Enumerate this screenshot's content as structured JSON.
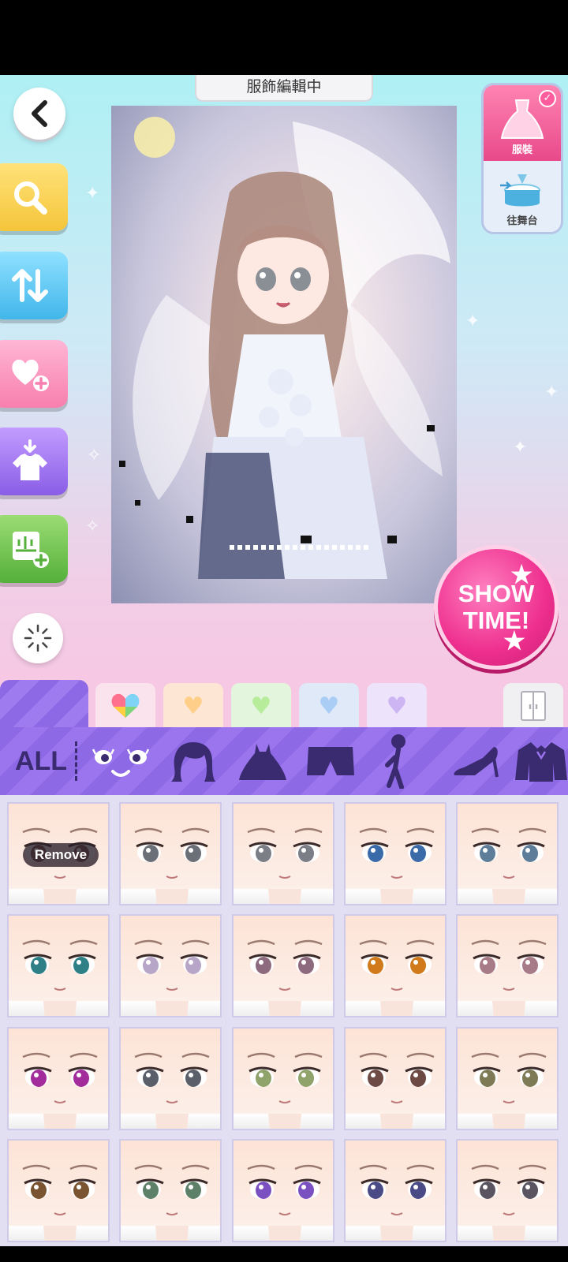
{
  "header": {
    "title": "服飾編輯中"
  },
  "side_buttons": [
    {
      "name": "back",
      "icon": "chevron-left-icon"
    },
    {
      "name": "search",
      "icon": "magnifier-icon",
      "color": "#f5c53a"
    },
    {
      "name": "sort",
      "icon": "sort-arrows-icon",
      "color": "#41b6ea"
    },
    {
      "name": "favorite-add",
      "icon": "heart-plus-icon",
      "color": "#f77fae"
    },
    {
      "name": "wear",
      "icon": "shirt-download-icon",
      "color": "#8a5de6"
    },
    {
      "name": "save-set",
      "icon": "board-plus-icon",
      "color": "#54b03a"
    }
  ],
  "mode_tabs": {
    "outfit_label": "服裝",
    "stage_label": "往舞台"
  },
  "showtime": {
    "line1": "SHOW",
    "line2": "TIME!"
  },
  "color_filters": [
    {
      "name": "multicolor",
      "color": "#fbe3ee"
    },
    {
      "name": "orange",
      "color": "#fde6d3"
    },
    {
      "name": "green",
      "color": "#e3f5dd"
    },
    {
      "name": "blue",
      "color": "#dfe9f8"
    },
    {
      "name": "purple",
      "color": "#ede3fb"
    }
  ],
  "categories": {
    "all_label": "ALL",
    "items": [
      "eyes-face-icon",
      "hair-icon",
      "dress-icon",
      "bottoms-icon",
      "pose-icon",
      "shoes-icon",
      "coat-icon"
    ]
  },
  "grid": {
    "remove_label": "Remove",
    "items": [
      {
        "iris": "#7a5548"
      },
      {
        "iris": "#6a6f78"
      },
      {
        "iris": "#7b7e86"
      },
      {
        "iris": "#3b6aa8"
      },
      {
        "iris": "#5d7d99"
      },
      {
        "iris": "#2e7f86"
      },
      {
        "iris": "#b7a6c8"
      },
      {
        "iris": "#8e6a7f"
      },
      {
        "iris": "#d07a1c"
      },
      {
        "iris": "#a77c88"
      },
      {
        "iris": "#a32c9c"
      },
      {
        "iris": "#5b5f69"
      },
      {
        "iris": "#8fa36a"
      },
      {
        "iris": "#6e4a44"
      },
      {
        "iris": "#7e7a56"
      },
      {
        "iris": "#7a5430"
      },
      {
        "iris": "#5f8068"
      },
      {
        "iris": "#7b51c2"
      },
      {
        "iris": "#4a4a86"
      },
      {
        "iris": "#5a5460"
      }
    ]
  }
}
